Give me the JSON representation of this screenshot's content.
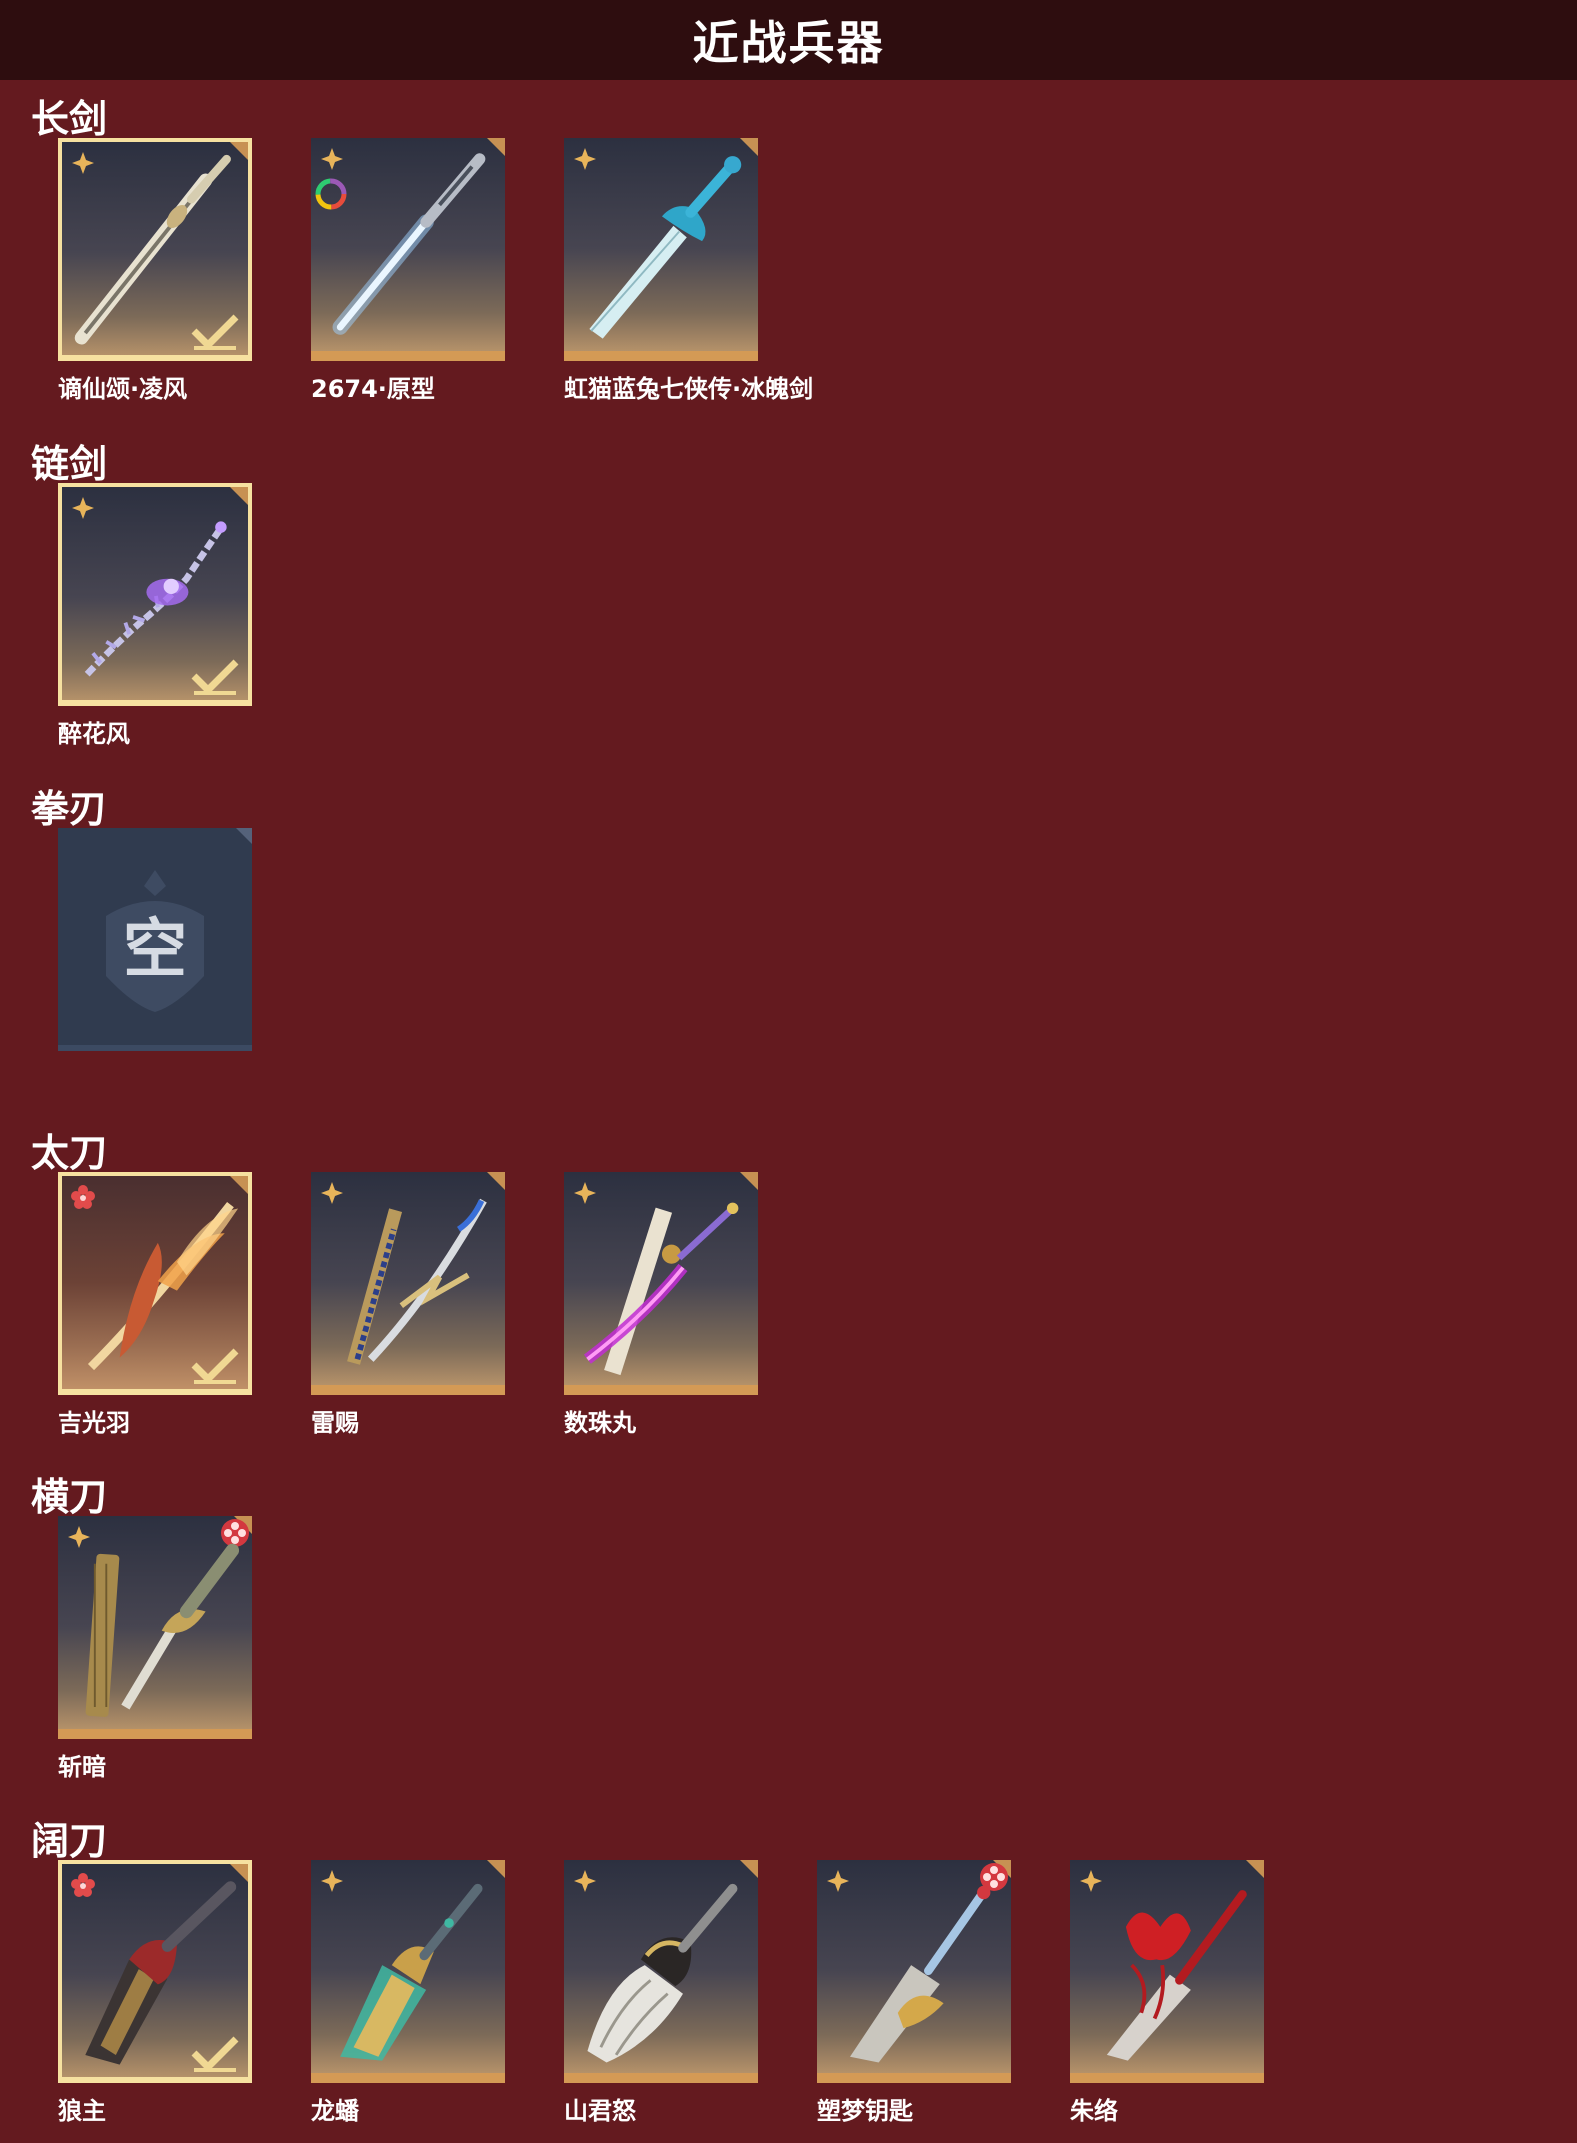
{
  "title": "近战兵器",
  "sections": [
    {
      "title": "长剑",
      "items": [
        {
          "label": "谪仙颂·凌风",
          "weapon_icon": "silver-longsword-icon",
          "equipped": true
        },
        {
          "label": "2674·原型",
          "weapon_icon": "energy-longsword-icon",
          "equipped": false
        },
        {
          "label": "虹猫蓝兔七侠传·冰魄剑",
          "weapon_icon": "ice-longsword-icon",
          "equipped": false
        }
      ]
    },
    {
      "title": "链剑",
      "items": [
        {
          "label": "醉花风",
          "weapon_icon": "violet-chainsword-icon",
          "equipped": true
        }
      ]
    },
    {
      "title": "拳刃",
      "items": [
        {
          "empty": true,
          "empty_text": "空"
        }
      ]
    },
    {
      "title": "太刀",
      "items": [
        {
          "label": "吉光羽",
          "weapon_icon": "flame-katana-icon",
          "equipped": true
        },
        {
          "label": "雷赐",
          "weapon_icon": "thunder-katana-icon",
          "equipped": false
        },
        {
          "label": "数珠丸",
          "weapon_icon": "purple-katana-icon",
          "equipped": false
        }
      ]
    },
    {
      "title": "横刀",
      "items": [
        {
          "label": "斩暗",
          "weapon_icon": "golden-hengdao-icon",
          "equipped": false
        }
      ]
    },
    {
      "title": "阔刀",
      "items": [
        {
          "label": "狼主",
          "weapon_icon": "wolf-broadblade-icon",
          "equipped": true
        },
        {
          "label": "龙蟠",
          "weapon_icon": "dragon-broadblade-icon",
          "equipped": false
        },
        {
          "label": "山君怒",
          "weapon_icon": "tiger-broadblade-icon",
          "equipped": false
        },
        {
          "label": "塑梦钥匙",
          "weapon_icon": "dream-key-broadblade-icon",
          "equipped": false
        },
        {
          "label": "朱络",
          "weapon_icon": "crimson-broadblade-icon",
          "equipped": false
        }
      ]
    }
  ],
  "colors": {
    "background": "#641a1f",
    "titlebar": "#2e0d0f",
    "equipped_border": "#f6e1a0",
    "card_bottom_accent": "#d49a55",
    "rarity_gold": "#e8b45a",
    "rarity_red": "#e24b4b"
  }
}
